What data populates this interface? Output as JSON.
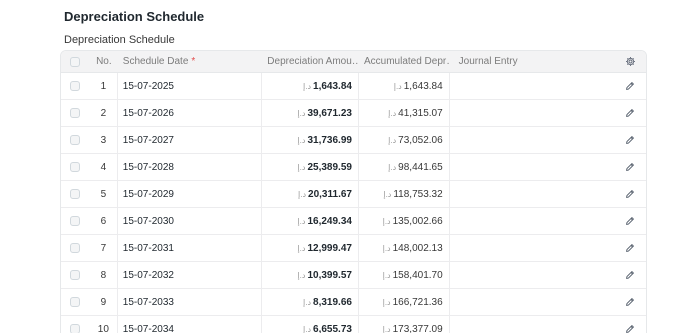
{
  "section_title": "Depreciation Schedule",
  "table_label": "Depreciation Schedule",
  "columns": {
    "no": "No.",
    "schedule_date": "Schedule Date",
    "required_mark": "*",
    "depreciation_amount": "Depreciation Amou…",
    "accumulated": "Accumulated Depr…",
    "journal_entry": "Journal Entry"
  },
  "currency": "د.إ",
  "rows": [
    {
      "no": "1",
      "date": "15-07-2025",
      "dep": "1,643.84",
      "acc": "1,643.84"
    },
    {
      "no": "2",
      "date": "15-07-2026",
      "dep": "39,671.23",
      "acc": "41,315.07"
    },
    {
      "no": "3",
      "date": "15-07-2027",
      "dep": "31,736.99",
      "acc": "73,052.06"
    },
    {
      "no": "4",
      "date": "15-07-2028",
      "dep": "25,389.59",
      "acc": "98,441.65"
    },
    {
      "no": "5",
      "date": "15-07-2029",
      "dep": "20,311.67",
      "acc": "118,753.32"
    },
    {
      "no": "6",
      "date": "15-07-2030",
      "dep": "16,249.34",
      "acc": "135,002.66"
    },
    {
      "no": "7",
      "date": "15-07-2031",
      "dep": "12,999.47",
      "acc": "148,002.13"
    },
    {
      "no": "8",
      "date": "15-07-2032",
      "dep": "10,399.57",
      "acc": "158,401.70"
    },
    {
      "no": "9",
      "date": "15-07-2033",
      "dep": "8,319.66",
      "acc": "166,721.36"
    },
    {
      "no": "10",
      "date": "15-07-2034",
      "dep": "6,655.73",
      "acc": "173,377.09"
    }
  ],
  "icons": {
    "settings": "gear-icon",
    "edit": "pencil-icon"
  }
}
